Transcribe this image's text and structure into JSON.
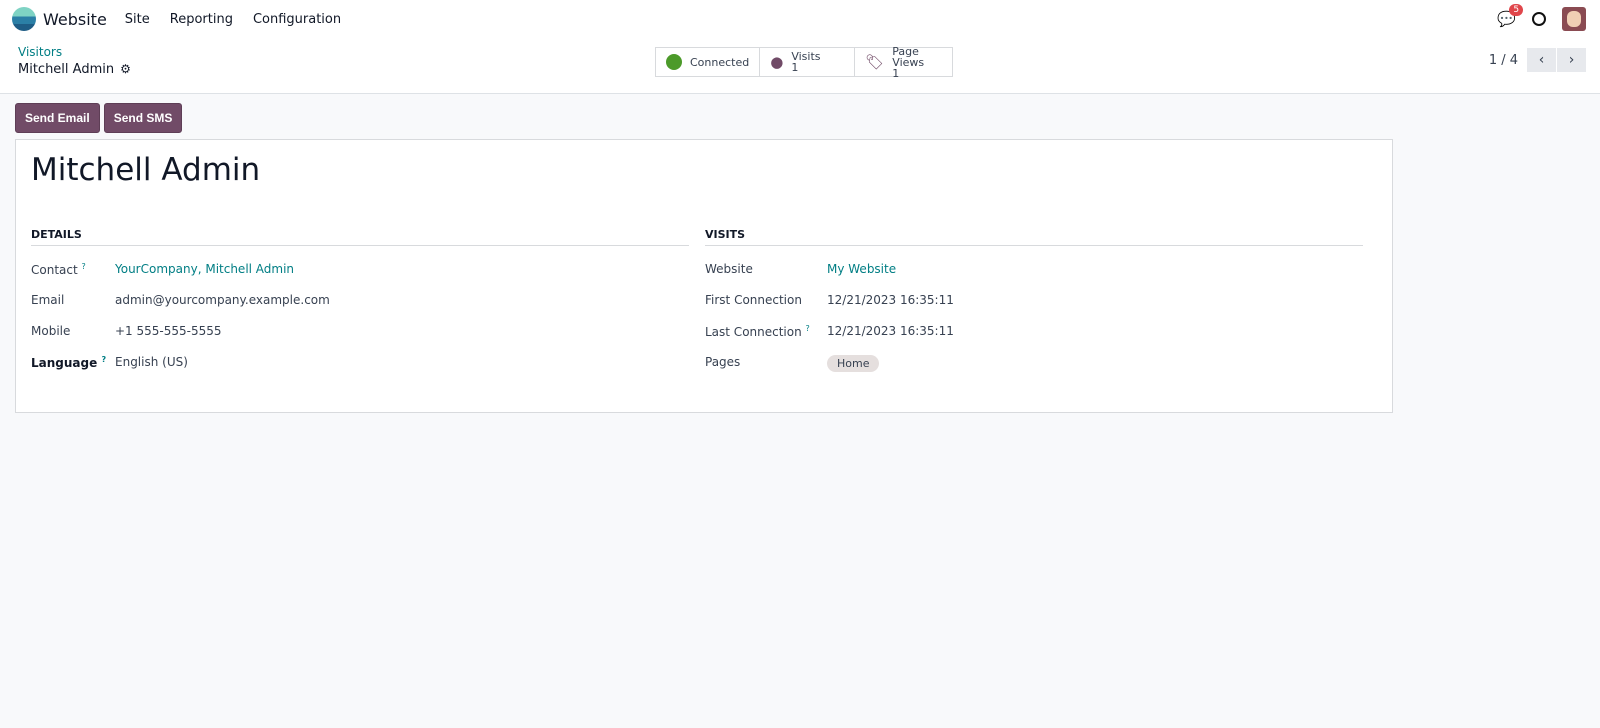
{
  "nav": {
    "app": "Website",
    "menu": [
      "Site",
      "Reporting",
      "Configuration"
    ],
    "chat_count": "5"
  },
  "breadcrumb": {
    "parent": "Visitors",
    "current": "Mitchell Admin"
  },
  "stats": {
    "connected": "Connected",
    "visits_label": "Visits",
    "visits_value": "1",
    "pageviews_label": "Page Views",
    "pageviews_value": "1"
  },
  "pager": {
    "text": "1 / 4"
  },
  "actions": {
    "send_email": "Send Email",
    "send_sms": "Send SMS"
  },
  "record": {
    "name": "Mitchell Admin",
    "details": {
      "heading": "DETAILS",
      "contact_label": "Contact",
      "contact": "YourCompany, Mitchell Admin",
      "email_label": "Email",
      "email": "admin@yourcompany.example.com",
      "mobile_label": "Mobile",
      "mobile": "+1 555-555-5555",
      "language_label": "Language",
      "language": "English (US)"
    },
    "visits": {
      "heading": "VISITS",
      "website_label": "Website",
      "website": "My Website",
      "first_label": "First Connection",
      "first": "12/21/2023 16:35:11",
      "last_label": "Last Connection",
      "last": "12/21/2023 16:35:11",
      "pages_label": "Pages",
      "pages": [
        "Home"
      ]
    }
  },
  "help_mark": "?",
  "colors": {
    "brand": "#714b67",
    "link": "#017e84",
    "connected": "#4c9a2a"
  }
}
